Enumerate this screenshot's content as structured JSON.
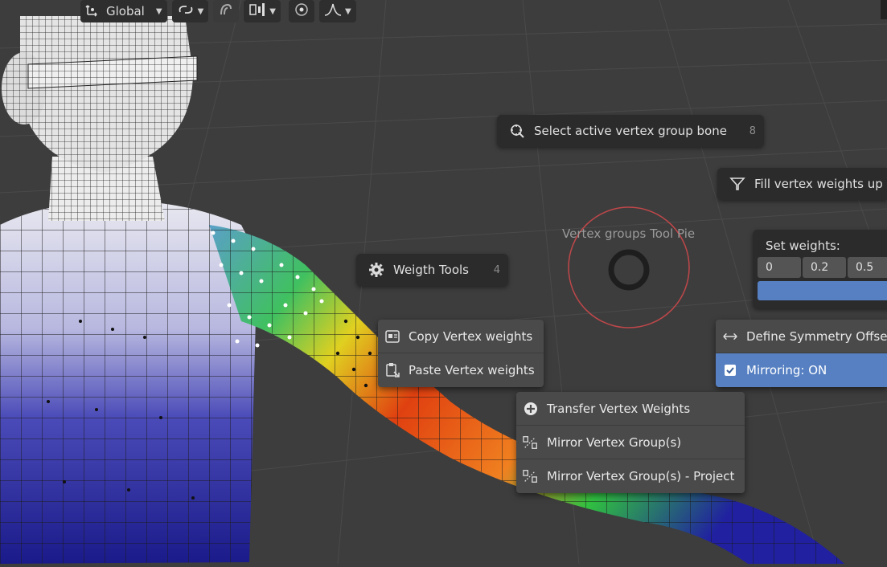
{
  "toolbar": {
    "transform_orientation": "Global",
    "icons": [
      "transform-orientation-icon",
      "link-icon",
      "snap-icon",
      "pivot-icon",
      "proportional-edit-icon",
      "falloff-icon"
    ]
  },
  "pie": {
    "title": "Vertex groups Tool Pie"
  },
  "pie_items": {
    "select_bone": {
      "label": "Select active vertex group bone",
      "hotkey": "8",
      "icon": "bone-select-icon"
    },
    "fill_weights": {
      "label": "Fill vertex weights up",
      "icon": "filter-icon"
    },
    "weight_tools": {
      "label": "Weigth Tools",
      "hotkey": "4",
      "icon": "gear-icon"
    }
  },
  "set_weights": {
    "title": "Set weights:",
    "values": [
      "0",
      "0.2",
      "0.5"
    ]
  },
  "copy_paste_menu": {
    "copy": "Copy Vertex weights",
    "paste": "Paste Vertex weights"
  },
  "symmetry_menu": {
    "define_offset": "Define Symmetry Offset",
    "mirroring": "Mirroring: ON",
    "mirroring_checked": true
  },
  "transfer_menu": {
    "transfer": "Transfer Vertex Weights",
    "mirror": "Mirror Vertex Group(s)",
    "mirror_project": "Mirror Vertex Group(s) - Project"
  },
  "colors": {
    "background": "#3d3d3d",
    "panel": "#2b2b2b",
    "menu": "#4a4a4a",
    "accent": "#5680c2",
    "pie_ring": "#c0474a"
  }
}
